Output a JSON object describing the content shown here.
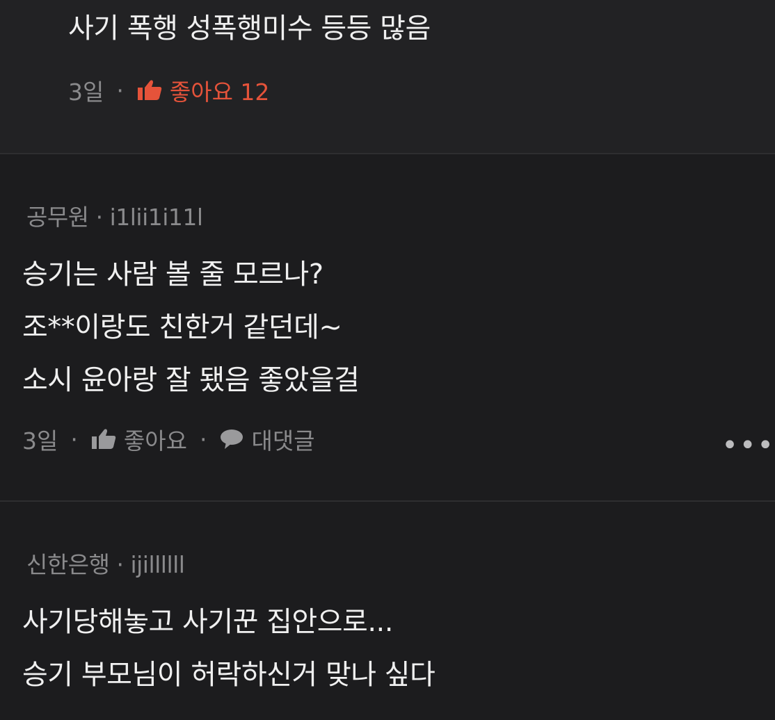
{
  "comments": [
    {
      "author": "",
      "body_lines": [
        "사기 폭행 성폭행미수 등등 많음"
      ],
      "time": "3일",
      "like_label": "좋아요 12",
      "liked": true
    },
    {
      "author_org": "공무원",
      "author_id": "i1lii1i11l",
      "body_lines": [
        "승기는 사람 볼 줄 모르나?",
        "조**이랑도 친한거 같던데~",
        "소시 윤아랑 잘 됐음 좋았을걸"
      ],
      "time": "3일",
      "like_label": "좋아요",
      "reply_label": "대댓글",
      "more_label": "•••"
    },
    {
      "author_org": "신한은행",
      "author_id": "ijillllll",
      "body_lines": [
        "사기당해놓고 사기꾼 집안으로...",
        "승기 부모님이 허락하신거 맞나 싶다"
      ]
    }
  ],
  "separator_dot": "·",
  "colors": {
    "background": "#1c1c1e",
    "text": "#f0f0f0",
    "muted": "#8a8a8c",
    "liked": "#e5533a"
  },
  "icons": [
    "thumbs-up-icon",
    "speech-bubble-icon",
    "more-dots-icon"
  ]
}
